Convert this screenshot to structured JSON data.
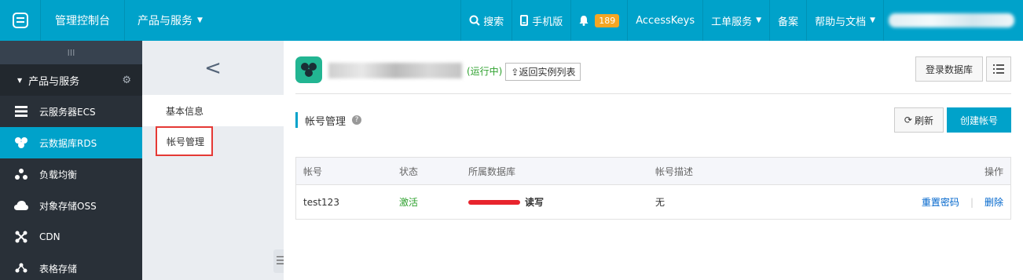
{
  "topbar": {
    "title": "管理控制台",
    "products": "产品与服务",
    "search": "搜索",
    "mobile": "手机版",
    "notifications_count": "189",
    "accesskeys": "AccessKeys",
    "tickets": "工单服务",
    "beian": "备案",
    "help": "帮助与文档"
  },
  "sidebar": {
    "collapse_glyph": "III",
    "section": "产品与服务",
    "items": [
      {
        "label": "云服务器ECS",
        "icon": "server-icon"
      },
      {
        "label": "云数据库RDS",
        "icon": "database-icon"
      },
      {
        "label": "负载均衡",
        "icon": "load-balancer-icon"
      },
      {
        "label": "对象存储OSS",
        "icon": "cloud-storage-icon"
      },
      {
        "label": "CDN",
        "icon": "cdn-icon"
      },
      {
        "label": "表格存储",
        "icon": "table-store-icon"
      }
    ]
  },
  "subnav": {
    "back_glyph": "<",
    "items": [
      {
        "label": "基本信息"
      },
      {
        "label": "帐号管理"
      }
    ]
  },
  "instance": {
    "status": "(运行中)",
    "back_to_list": "返回实例列表",
    "login_db": "登录数据库"
  },
  "accounts": {
    "title": "帐号管理",
    "refresh": "刷新",
    "create": "创建帐号",
    "columns": [
      "帐号",
      "状态",
      "所属数据库",
      "帐号描述",
      "操作"
    ],
    "rows": [
      {
        "account": "test123",
        "status": "激活",
        "db_permission": "读写",
        "description": "无",
        "action_reset": "重置密码",
        "action_delete": "删除"
      }
    ]
  },
  "colors": {
    "topbar": "#00a2ca",
    "sidebar": "#293038",
    "active": "#00a2ca",
    "status_ok": "#2fa12f",
    "link": "#0066cc",
    "highlight_box": "#e53935"
  }
}
